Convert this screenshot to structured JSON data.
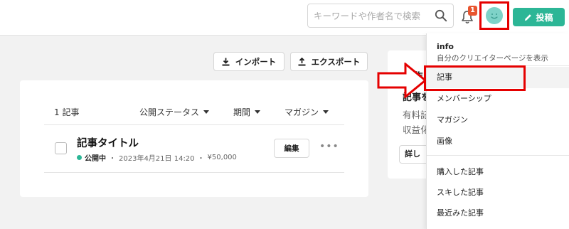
{
  "header": {
    "search_placeholder": "キーワードや作者名で検索",
    "notification_count": "1",
    "post_label": "投稿"
  },
  "toolbar": {
    "import_label": "インポート",
    "export_label": "エクスポート"
  },
  "list": {
    "count_label": "1 記事",
    "columns": [
      "公開ステータス",
      "期間",
      "マガジン"
    ],
    "rows": [
      {
        "title": "記事タイトル",
        "status": "公開中",
        "sep": "・",
        "date": "2023年4月21日 14:20",
        "price": "¥50,000",
        "edit_label": "編集",
        "more_label": "•••"
      }
    ]
  },
  "side_card": {
    "top_text": "作",
    "title": "記事を",
    "text1": "有料記",
    "text2": "収益化",
    "button_label": "詳し"
  },
  "dropdown": {
    "info_title": "info",
    "info_sub": "自分のクリエイターページを表示",
    "items": [
      "記事",
      "メンバーシップ",
      "マガジン",
      "画像",
      "購入した記事",
      "スキした記事",
      "最近みた記事"
    ]
  },
  "colors": {
    "accent": "#2cb696",
    "highlight": "#e50000",
    "badge": "#e8552f"
  }
}
